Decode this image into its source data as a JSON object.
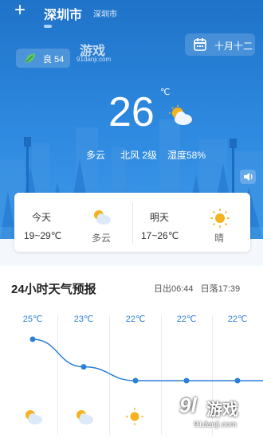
{
  "header": {
    "add_icon": "plus-icon",
    "city": "深圳市",
    "district": "深圳市"
  },
  "aqi": {
    "label": "良 54",
    "icon": "leaf-icon"
  },
  "watermark_top": {
    "brand": "游戏",
    "url": "91danji.com"
  },
  "date_button": {
    "label": "十月十二",
    "icon": "calendar-icon"
  },
  "current": {
    "temperature": "26",
    "unit": "℃",
    "condition": "多云",
    "wind": "北风 2级",
    "humidity": "湿度58%",
    "speaker_icon": "speaker-icon"
  },
  "forecast_cards": [
    {
      "day": "今天",
      "range": "19~29℃",
      "condition": "多云",
      "icon": "partly-cloudy-icon"
    },
    {
      "day": "明天",
      "range": "17~26℃",
      "condition": "晴",
      "icon": "sun-icon"
    }
  ],
  "hourly": {
    "title": "24小时天气预报",
    "sunrise": "日出06:44",
    "sunset": "日落17:39",
    "temps": [
      "25℃",
      "23℃",
      "22℃",
      "22℃",
      "22℃"
    ],
    "values": [
      25,
      23,
      22,
      22,
      22
    ],
    "icons": [
      "partly-cloudy-icon",
      "partly-cloudy-icon",
      "sun-icon"
    ]
  },
  "watermark_bottom": {
    "brand": "游戏",
    "url": "91danji.com"
  },
  "colors": {
    "hero_top": "#1f73c8",
    "hero_bottom": "#3c99ea",
    "accent": "#2a7fd6",
    "sun": "#f5b21f"
  }
}
